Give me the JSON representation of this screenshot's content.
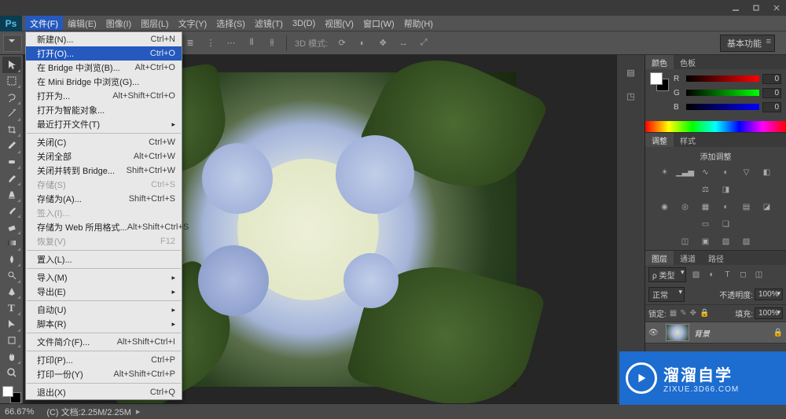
{
  "app": {
    "badge": "Ps"
  },
  "menus": {
    "file": "文件(F)",
    "edit": "编辑(E)",
    "image": "图像(I)",
    "layer": "图层(L)",
    "type": "文字(Y)",
    "select": "选择(S)",
    "filter": "滤镜(T)",
    "threeD": "3D(D)",
    "view": "视图(V)",
    "window": "窗口(W)",
    "help": "帮助(H)"
  },
  "file_menu": [
    {
      "label": "新建(N)...",
      "key": "Ctrl+N"
    },
    {
      "label": "打开(O)...",
      "key": "Ctrl+O",
      "selected": true
    },
    {
      "label": "在 Bridge 中浏览(B)...",
      "key": "Alt+Ctrl+O"
    },
    {
      "label": "在 Mini Bridge 中浏览(G)..."
    },
    {
      "label": "打开为...",
      "key": "Alt+Shift+Ctrl+O"
    },
    {
      "label": "打开为智能对象..."
    },
    {
      "label": "最近打开文件(T)",
      "submenu": true
    },
    {
      "sep": true
    },
    {
      "label": "关闭(C)",
      "key": "Ctrl+W"
    },
    {
      "label": "关闭全部",
      "key": "Alt+Ctrl+W"
    },
    {
      "label": "关闭并转到 Bridge...",
      "key": "Shift+Ctrl+W"
    },
    {
      "label": "存储(S)",
      "key": "Ctrl+S",
      "disabled": true
    },
    {
      "label": "存储为(A)...",
      "key": "Shift+Ctrl+S"
    },
    {
      "label": "签入(I)...",
      "disabled": true
    },
    {
      "label": "存储为 Web 所用格式...",
      "key": "Alt+Shift+Ctrl+S"
    },
    {
      "label": "恢复(V)",
      "key": "F12",
      "disabled": true
    },
    {
      "sep": true
    },
    {
      "label": "置入(L)..."
    },
    {
      "sep": true
    },
    {
      "label": "导入(M)",
      "submenu": true
    },
    {
      "label": "导出(E)",
      "submenu": true
    },
    {
      "sep": true
    },
    {
      "label": "自动(U)",
      "submenu": true
    },
    {
      "label": "脚本(R)",
      "submenu": true
    },
    {
      "sep": true
    },
    {
      "label": "文件简介(F)...",
      "key": "Alt+Shift+Ctrl+I"
    },
    {
      "sep": true
    },
    {
      "label": "打印(P)...",
      "key": "Ctrl+P"
    },
    {
      "label": "打印一份(Y)",
      "key": "Alt+Shift+Ctrl+P"
    },
    {
      "sep": true
    },
    {
      "label": "退出(X)",
      "key": "Ctrl+Q"
    }
  ],
  "options": {
    "mode3d": "3D 模式:",
    "preset": "基本功能"
  },
  "color_panel": {
    "tab1": "颜色",
    "tab2": "色板",
    "r": {
      "label": "R",
      "value": "0"
    },
    "g": {
      "label": "G",
      "value": "0"
    },
    "b": {
      "label": "B",
      "value": "0"
    }
  },
  "adjust_panel": {
    "tab1": "调整",
    "tab2": "样式",
    "title": "添加调整"
  },
  "layers_panel": {
    "tab1": "图层",
    "tab2": "通道",
    "tab3": "路径",
    "kind": "ρ 类型",
    "blend": "正常",
    "opacity_label": "不透明度:",
    "opacity": "100%",
    "lock_label": "锁定:",
    "fill_label": "填充:",
    "fill": "100%",
    "layer_name": "背景"
  },
  "status": {
    "zoom": "66.67%",
    "doc": "(C) 文档:2.25M/2.25M"
  },
  "watermark": {
    "big": "溜溜自学",
    "small": "ZIXUE.3D66.COM"
  }
}
